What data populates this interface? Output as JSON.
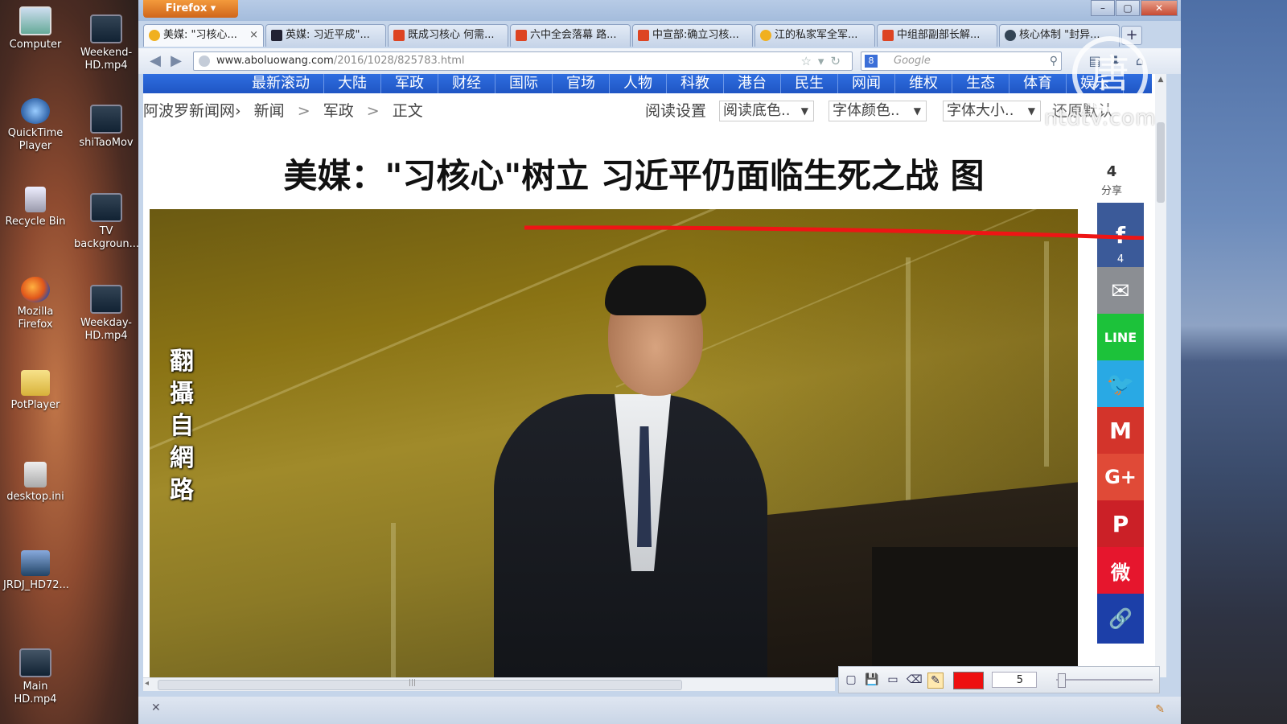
{
  "desktop": {
    "icons": [
      {
        "label": "Computer"
      },
      {
        "label": "Weekend-HD.mp4"
      },
      {
        "label": "QuickTime Player"
      },
      {
        "label": "shiTaoMov"
      },
      {
        "label": "Recycle Bin"
      },
      {
        "label": "TV backgroun..."
      },
      {
        "label": "Mozilla Firefox"
      },
      {
        "label": "Weekday-HD.mp4"
      },
      {
        "label": "PotPlayer"
      },
      {
        "label": "desktop.ini"
      },
      {
        "label": "JRDJ_HD72..."
      },
      {
        "label": "Main HD.mp4"
      }
    ]
  },
  "browser": {
    "app_button": "Firefox ▾",
    "tabs": [
      {
        "label": "美媒: \"习核心...",
        "close": "×"
      },
      {
        "label": "英媒: 习近平成\"..."
      },
      {
        "label": "既成习核心 何需..."
      },
      {
        "label": "六中全会落幕 路..."
      },
      {
        "label": "中宣部:确立习核..."
      },
      {
        "label": "江的私家军全军..."
      },
      {
        "label": "中组部副部长解..."
      },
      {
        "label": "核心体制 \"封异..."
      }
    ],
    "new_tab": "+",
    "url_domain": "www.aboluowang.com",
    "url_path": "/2016/1028/825783.html",
    "search_placeholder": "Google"
  },
  "site": {
    "nav": [
      "最新滚动",
      "大陆",
      "军政",
      "财经",
      "国际",
      "官场",
      "人物",
      "科教",
      "港台",
      "民生",
      "网闻",
      "维权",
      "生态",
      "体育",
      "娱乐"
    ],
    "breadcrumb": [
      "阿波罗新闻网›",
      "新闻",
      ">",
      "军政",
      ">",
      "正文"
    ],
    "reading_settings": "阅读设置",
    "bg_select": "阅读底色..",
    "font_color_select": "字体颜色..",
    "font_size_select": "字体大小..",
    "reset": "还原默认"
  },
  "article": {
    "headline": "美媒：\"习核心\"树立 习近平仍面临生死之战 图",
    "share_count": "4",
    "share_label": "分享",
    "photo_caption": "翻攝自網路"
  },
  "share_buttons": {
    "facebook": "f",
    "facebook_count": "4",
    "email": "✉",
    "line": "LINE",
    "twitter": "🐦",
    "gmail": "M",
    "googleplus": "G+",
    "pinterest": "P",
    "weibo": "微",
    "link": "🔗"
  },
  "draw_tool": {
    "size_value": "5",
    "active_color": "#ee1010"
  },
  "watermark": {
    "text": "ntdtv.com",
    "logo_glyph": "唐"
  }
}
